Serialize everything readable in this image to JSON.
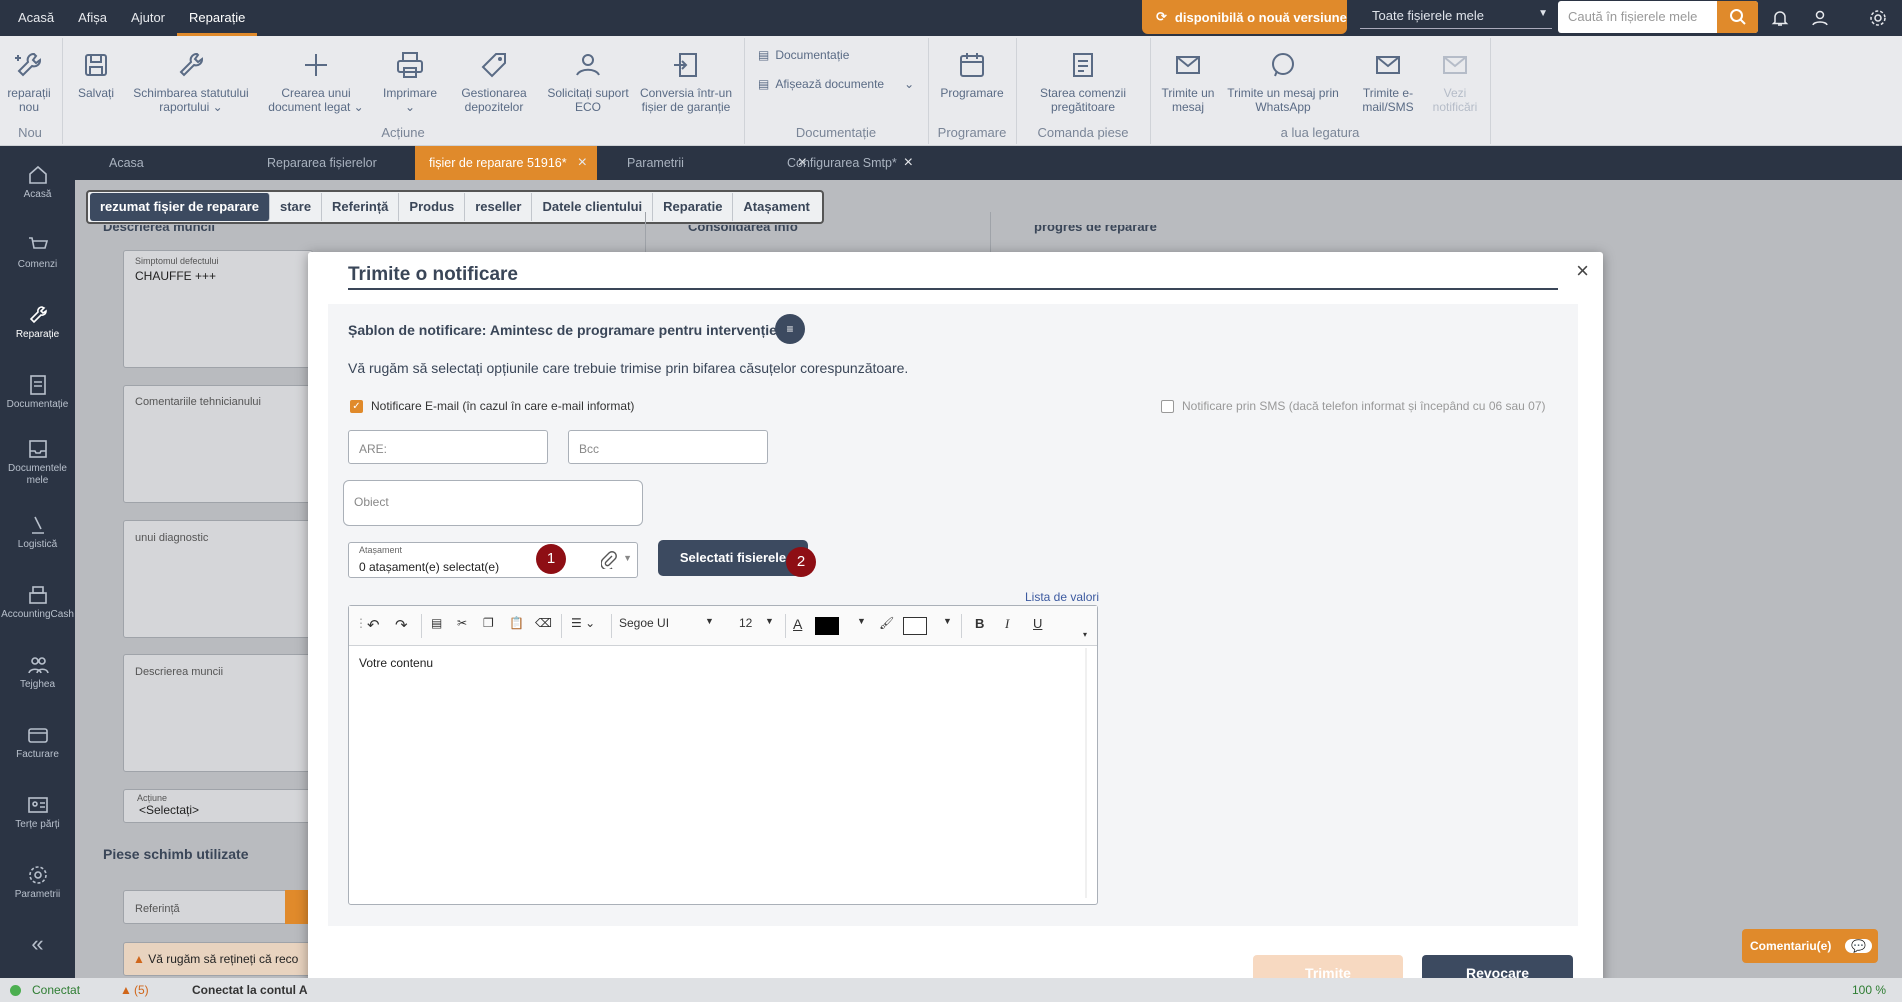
{
  "menu": [
    "Acasă",
    "Afișa",
    "Ajutor",
    "Reparație"
  ],
  "topbar": {
    "update_label": "disponibilă o nouă versiune",
    "scope": "Toate fișierele mele",
    "search_placeholder": "Caută în fișierele mele"
  },
  "ribbon": {
    "new_repair": "reparații nou",
    "save": "Salvați",
    "change_status": "Schimbarea statutului raportului",
    "create_doc": "Crearea unui document legat",
    "print": "Imprimare",
    "manage_deposit": "Gestionarea depozitelor",
    "eco_support": "Solicitați suport ECO",
    "convert": "Conversia într-un fișier de garanție",
    "documents": "Documentație",
    "show_docs": "Afișează documente",
    "schedule": "Programare",
    "parts_status": "Starea comenzii pregătitoare",
    "send_msg": "Trimite un mesaj",
    "whatsapp": "Trimite un mesaj prin WhatsApp",
    "email_sms": "Trimite e-mail/SMS",
    "view_notif": "Vezi notificări",
    "groups": {
      "new": "Nou",
      "actions": "Acțiune",
      "documentation": "Documentație",
      "schedule": "Programare",
      "parts": "Comanda piese",
      "contact": "a lua legatura"
    }
  },
  "sidebar": [
    "Acasă",
    "Comenzi",
    "Reparație",
    "Documentație",
    "Documentele mele",
    "Logistică",
    "AccountingCash",
    "Tejghea",
    "Facturare",
    "Terțe părți",
    "Parametrii"
  ],
  "tabs": [
    "Acasa",
    "Repararea fișierelor",
    "fișier de reparare 51916*",
    "Parametrii",
    "Configurarea Smtp*"
  ],
  "subtabs": [
    "rezumat fișier de reparare",
    "stare",
    "Referință",
    "Produs",
    "reseller",
    "Datele clientului",
    "Reparatie",
    "Atașament"
  ],
  "background": {
    "symptom_label": "Simptomul defectului",
    "symptom_value": "CHAUFFE +++",
    "tech_comments": "Comentariile tehnicianului",
    "diagnostic": "unui diagnostic",
    "work_desc": "Descrierea muncii",
    "action_label": "Acțiune",
    "action_value": "<Selectați>",
    "parts_heading": "Piese schimb utilizate",
    "reference": "Referință",
    "warning": "Vă rugăm să rețineți că reco",
    "heading_left": "Descrierea muncii",
    "heading_mid": "Consolidarea info",
    "heading_right": "progres de reparare"
  },
  "modal": {
    "title": "Trimite o notificare",
    "template": "Șablon de notificare: Amintesc de programare pentru intervenție",
    "instructions": "Vă rugăm să selectați opțiunile care trebuie trimise prin bifarea căsuțelor corespunzătoare.",
    "email_option": "Notificare E-mail (în cazul în care e-mail informat)",
    "sms_option": "Notificare prin SMS (dacă telefon informat și începând cu 06 sau 07)",
    "to_placeholder": "ARE:",
    "bcc_placeholder": "Bcc",
    "subject_placeholder": "Obiect",
    "attachment_label": "Atașament",
    "attachment_value": "0 atașament(e) selectat(e)",
    "select_files": "Selectati fisierele",
    "badge1": "1",
    "badge2": "2",
    "value_list": "Lista de valori",
    "font": "Segoe UI",
    "font_size": "12",
    "editor_text": "Votre contenu",
    "send": "Trimite",
    "cancel": "Revocare"
  },
  "status": {
    "connected": "Conectat",
    "warnings": "(5)",
    "account": "Conectat la contul A",
    "zoom": "100 %"
  },
  "comments_btn": "Comentariu(e)",
  "colors": {
    "accent": "#e08a2b",
    "dark": "#2b3444",
    "button": "#3c4a60",
    "badge": "#8e0e14"
  }
}
